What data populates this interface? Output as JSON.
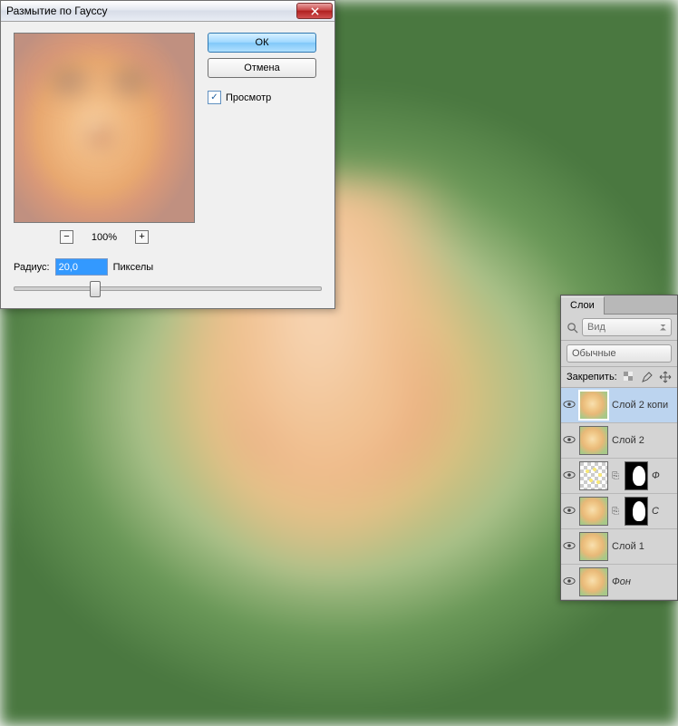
{
  "dialog": {
    "title": "Размытие по Гауссу",
    "ok": "ОК",
    "cancel": "Отмена",
    "preview": "Просмотр",
    "zoom": "100%",
    "radius_label": "Радиус:",
    "radius_value": "20,0",
    "radius_unit": "Пикселы"
  },
  "layers_panel": {
    "tab": "Слои",
    "kind": "Вид",
    "blend_mode": "Обычные",
    "lock_label": "Закрепить:",
    "items": [
      {
        "name": "Слой 2 копи",
        "selected": true,
        "type": "image"
      },
      {
        "name": "Слой 2",
        "selected": false,
        "type": "image"
      },
      {
        "name": "Ф",
        "selected": false,
        "type": "masked-checker"
      },
      {
        "name": "С",
        "selected": false,
        "type": "masked-image"
      },
      {
        "name": "Слой 1",
        "selected": false,
        "type": "image"
      },
      {
        "name": "Фон",
        "selected": false,
        "type": "image",
        "italic": true
      }
    ]
  }
}
